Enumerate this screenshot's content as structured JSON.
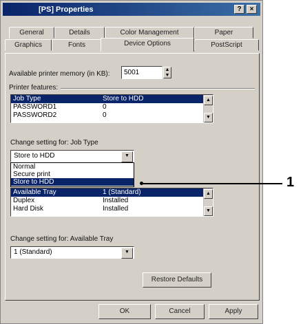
{
  "window": {
    "title": "[PS] Properties",
    "help_glyph": "?",
    "close_glyph": "×"
  },
  "tabs_row1": [
    "General",
    "Details",
    "Color Management",
    "Paper"
  ],
  "tabs_row2": [
    "Graphics",
    "Fonts",
    "Device Options",
    "PostScript"
  ],
  "active_tab": "Device Options",
  "memory": {
    "label": "Available printer memory (in KB):",
    "value": "5001"
  },
  "printer_features": {
    "group_label": "Printer features:",
    "rows": [
      {
        "name": "Job Type",
        "value": "Store to HDD",
        "selected": true
      },
      {
        "name": "PASSWORD1",
        "value": "0",
        "selected": false
      },
      {
        "name": "PASSWORD2",
        "value": "0",
        "selected": false
      }
    ]
  },
  "job_type_setting": {
    "label": "Change setting for: Job Type",
    "current": "Store to HDD",
    "options": [
      "Normal",
      "Secure print",
      "Store to HDD"
    ],
    "selected_option": "Store to HDD"
  },
  "installable_options": {
    "rows": [
      {
        "name": "Available Tray",
        "value": "1 (Standard)",
        "selected": true
      },
      {
        "name": "Duplex",
        "value": "Installed",
        "selected": false
      },
      {
        "name": "Hard Disk",
        "value": "Installed",
        "selected": false
      }
    ]
  },
  "tray_setting": {
    "label": "Change setting for: Available Tray",
    "current": "1 (Standard)"
  },
  "buttons": {
    "restore_defaults": "Restore Defaults",
    "ok": "OK",
    "cancel": "Cancel",
    "apply": "Apply"
  },
  "callout": {
    "number": "1"
  },
  "colors": {
    "titlebar": "#0a246a",
    "selection": "#0a246a",
    "face": "#d4d0c8"
  }
}
